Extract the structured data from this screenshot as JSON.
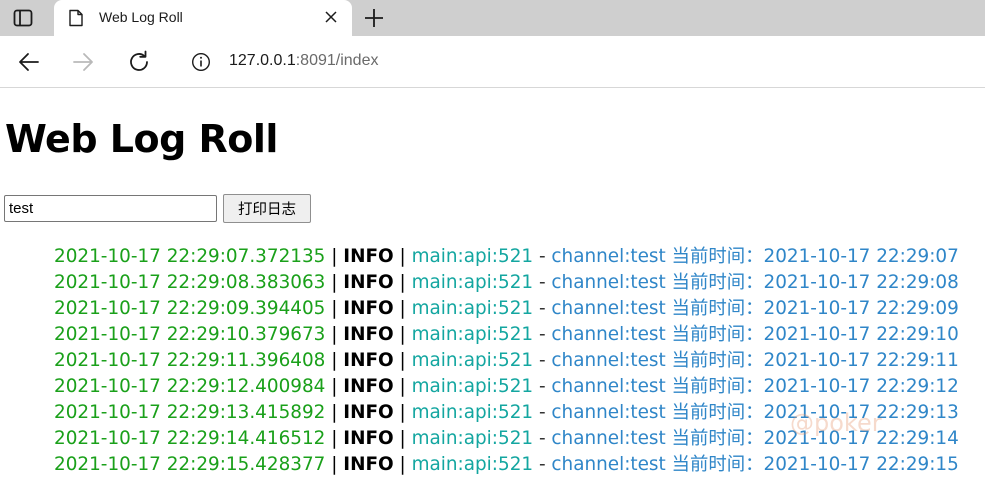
{
  "browser": {
    "tab": {
      "title": "Web Log Roll"
    },
    "address": {
      "host": "127.0.0.1",
      "rest": ":8091/index"
    }
  },
  "page": {
    "title": "Web Log Roll",
    "input_value": "test",
    "button_label": "打印日志",
    "logs": [
      {
        "time": "2021-10-17 22:29:07.372135",
        "level": "INFO",
        "loc": "main:api:521",
        "msg": "channel:test 当前时间：2021-10-17 22:29:07"
      },
      {
        "time": "2021-10-17 22:29:08.383063",
        "level": "INFO",
        "loc": "main:api:521",
        "msg": "channel:test 当前时间：2021-10-17 22:29:08"
      },
      {
        "time": "2021-10-17 22:29:09.394405",
        "level": "INFO",
        "loc": "main:api:521",
        "msg": "channel:test 当前时间：2021-10-17 22:29:09"
      },
      {
        "time": "2021-10-17 22:29:10.379673",
        "level": "INFO",
        "loc": "main:api:521",
        "msg": "channel:test 当前时间：2021-10-17 22:29:10"
      },
      {
        "time": "2021-10-17 22:29:11.396408",
        "level": "INFO",
        "loc": "main:api:521",
        "msg": "channel:test 当前时间：2021-10-17 22:29:11"
      },
      {
        "time": "2021-10-17 22:29:12.400984",
        "level": "INFO",
        "loc": "main:api:521",
        "msg": "channel:test 当前时间：2021-10-17 22:29:12"
      },
      {
        "time": "2021-10-17 22:29:13.415892",
        "level": "INFO",
        "loc": "main:api:521",
        "msg": "channel:test 当前时间：2021-10-17 22:29:13"
      },
      {
        "time": "2021-10-17 22:29:14.416512",
        "level": "INFO",
        "loc": "main:api:521",
        "msg": "channel:test 当前时间：2021-10-17 22:29:14"
      },
      {
        "time": "2021-10-17 22:29:15.428377",
        "level": "INFO",
        "loc": "main:api:521",
        "msg": "channel:test 当前时间：2021-10-17 22:29:15"
      }
    ],
    "watermark": "@poker"
  },
  "icons": {
    "window": "window-icon",
    "tab_page": "page-icon",
    "close": "close-icon",
    "new_tab": "plus-icon",
    "back": "back-arrow-icon",
    "forward": "forward-arrow-icon",
    "reload": "reload-icon",
    "info": "info-icon"
  },
  "colors": {
    "time": "#1aa01a",
    "level": "#000000",
    "location": "#13a6a0",
    "message": "#2f86c8"
  }
}
